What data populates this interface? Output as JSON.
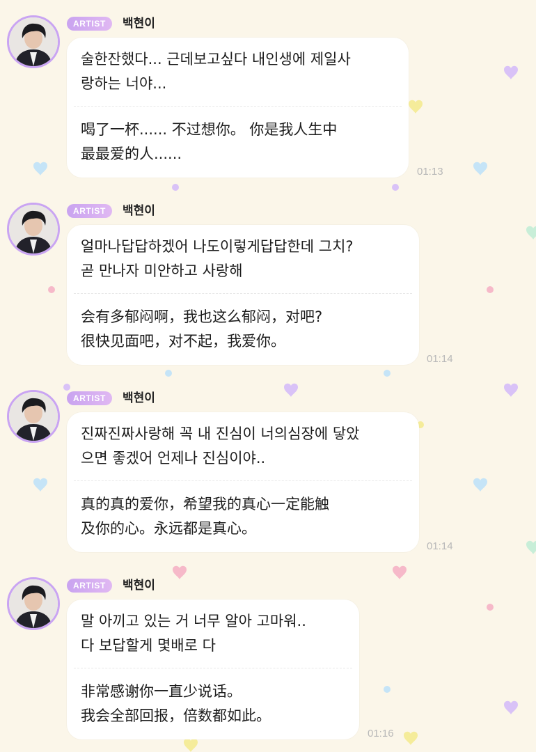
{
  "messages": [
    {
      "badge": "ARTIST",
      "sender": "백현이",
      "korean": "술한잔했다... 근데보고싶다 내인생에 제일사\n랑하는 너야...",
      "chinese": "喝了一杯...... 不过想你。 你是我人生中\n最最爱的人......",
      "time": "01:13"
    },
    {
      "badge": "ARTIST",
      "sender": "백현이",
      "korean": "얼마나답답하겠어 나도이렇게답답한데 그치?\n곧 만나자 미안하고 사랑해",
      "chinese": "会有多郁闷啊，我也这么郁闷，对吧?\n很快见面吧，对不起，我爱你。",
      "time": "01:14"
    },
    {
      "badge": "ARTIST",
      "sender": "백현이",
      "korean": "진짜진짜사랑해 꼭 내 진심이 너의심장에 닿았\n으면 좋겠어 언제나 진심이야..",
      "chinese": "真的真的爱你，希望我的真心一定能触\n及你的心。永远都是真心。",
      "time": "01:14"
    },
    {
      "badge": "ARTIST",
      "sender": "백현이",
      "korean": "말 아끼고 있는 거 너무 알아 고마워..\n다 보답할게 몇배로 다",
      "chinese": "非常感谢你一直少说话。\n我会全部回报，倍数都如此。",
      "time": "01:16"
    }
  ],
  "colors": {
    "background": "#fbf6e9",
    "badge": "#c9a3f0",
    "avatar_ring": "#c9a4f2",
    "bubble": "#ffffff",
    "time": "#b8b8b8"
  }
}
